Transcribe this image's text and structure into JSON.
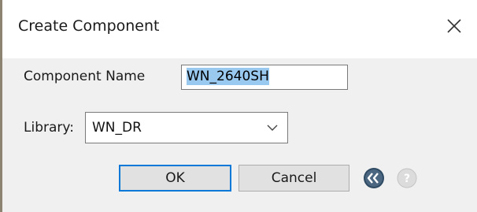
{
  "dialog": {
    "title": "Create Component",
    "close_icon": "close-icon"
  },
  "form": {
    "component_name_label": "Component Name",
    "component_name_value": "WN_2640SH",
    "library_label": "Library:",
    "library_value": "WN_DR"
  },
  "buttons": {
    "ok_label": "OK",
    "cancel_label": "Cancel"
  },
  "icons": {
    "collapse": "double-chevron-left-icon",
    "help": "help-icon"
  },
  "colors": {
    "accent": "#0078d7",
    "selection": "#99c9ef"
  }
}
